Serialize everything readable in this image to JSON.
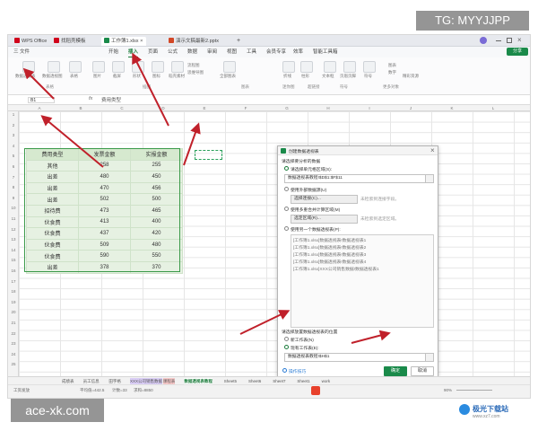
{
  "watermark_top": "TG: MYYJJPP",
  "watermark_bottom": "ace-xk.com",
  "site_logo": "极光下载站",
  "site_url": "www.xz7.com",
  "titlebar": {
    "tabs": [
      {
        "label": "WPS Office",
        "color": "#d0021b"
      },
      {
        "label": "找稻壳模板",
        "color": "#d0021b"
      },
      {
        "label": "工作簿1.xlsx",
        "color": "#1a8a4a"
      },
      {
        "label": "演示文稿最新2.pptx",
        "color": "#d24726"
      }
    ],
    "new_tab": "+"
  },
  "menu": {
    "file": "三 文件",
    "items": [
      "开始",
      "插入",
      "页面",
      "公式",
      "数据",
      "审阅",
      "视图",
      "工具",
      "会员专享",
      "效率",
      "智能工具箱"
    ],
    "share": "分享"
  },
  "ribbon": {
    "labels": [
      "数据透视表",
      "数据透视图",
      "表格",
      "图片",
      "截屏",
      "形状",
      "图标",
      "稻壳素材",
      "流程图",
      "思维导图",
      "全部图表",
      "折线",
      "柱形",
      "盈亏",
      "文本框",
      "页眉页脚",
      "艺术字",
      "附件",
      "对象",
      "符号",
      "公式",
      "超链接"
    ],
    "groups": [
      "表格",
      "插图",
      "图表",
      "迷你图",
      "超链接",
      "符号",
      "更多对象"
    ],
    "right_items": [
      "图表",
      "数字",
      "精彩资源"
    ]
  },
  "formula_bar": {
    "cell_ref": "B1",
    "fx": "fx",
    "content": "费用类型"
  },
  "columns": [
    "A",
    "B",
    "C",
    "D",
    "E",
    "F",
    "G",
    "H",
    "I",
    "J",
    "K",
    "L",
    "M"
  ],
  "rows": [
    "1",
    "2",
    "3",
    "4",
    "5",
    "6",
    "7",
    "8",
    "9",
    "10",
    "11",
    "12",
    "13",
    "14",
    "15",
    "16",
    "17",
    "18",
    "19",
    "20",
    "21",
    "22",
    "23",
    "24",
    "25"
  ],
  "table": {
    "headers": [
      "费用类型",
      "发票金额",
      "实报金额"
    ],
    "rows": [
      [
        "其他",
        "258",
        "255"
      ],
      [
        "出差",
        "480",
        "450"
      ],
      [
        "出差",
        "470",
        "456"
      ],
      [
        "出差",
        "502",
        "500"
      ],
      [
        "招待费",
        "473",
        "465"
      ],
      [
        "伙食费",
        "413",
        "400"
      ],
      [
        "伙食费",
        "437",
        "420"
      ],
      [
        "伙食费",
        "509",
        "480"
      ],
      [
        "伙食费",
        "590",
        "550"
      ],
      [
        "出差",
        "378",
        "370"
      ]
    ]
  },
  "dialog": {
    "title": "创建数据透视表",
    "section1": "请选择要分析的数据",
    "opt_range": "请选择单元格区域(S):",
    "range_value": "数据透视表教程!$D$1:$F$11",
    "opt_external": "使用外部数据源(U)",
    "external_btn": "选择连接(C)...",
    "external_hint": "未检索到连接字段。",
    "opt_multi": "使用多重合并计算区域(M)",
    "multi_btn": "选定区域(R)...",
    "multi_hint": "未检索到选定区域。",
    "opt_other": "使用另一个数据透视表(P):",
    "other_list": [
      "[工作簿1.xlsx]数据透视表!数据透视表1",
      "[工作簿1.xlsx]数据透视表!数据透视表2",
      "[工作簿1.xlsx]数据透视表!数据透视表3",
      "[工作簿1.xlsx]数据透视表!数据透视表4",
      "[工作簿1.xlsx]XXX公司销售数据!数据透视表1"
    ],
    "section2": "请选择放置数据透视表的位置",
    "opt_new": "新工作表(N)",
    "opt_existing": "现有工作表(E):",
    "existing_value": "数据透视表教程!$H$1",
    "tips": "操作技巧",
    "ok": "确定",
    "cancel": "取消"
  },
  "sheets": [
    "成绩表",
    "员工信息",
    "田字格",
    "XXX公司销售数据",
    "课程表",
    "数据透视表教程",
    "Sheet5",
    "Sheet6",
    "Sheet7",
    "Sheet1",
    "work"
  ],
  "status": {
    "left": "工资发放",
    "avg": "平均值=442.5",
    "count": "计数=33",
    "sum": "求和=8850",
    "zoom": "90%"
  }
}
